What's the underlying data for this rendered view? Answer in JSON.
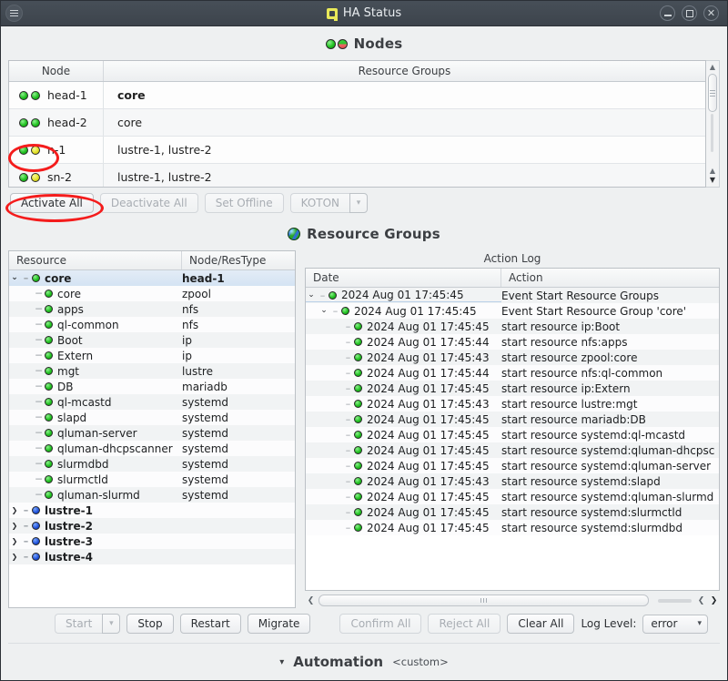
{
  "window": {
    "title": "HA Status",
    "app_icon": "qlustar-icon",
    "menu_icon": "hamburger-menu-icon",
    "minimize_label": "_",
    "maximize_label": "□",
    "close_label": "✕"
  },
  "nodes_section": {
    "title": "Nodes",
    "icon": "node-status-leds-icon",
    "columns": [
      "Node",
      "Resource Groups"
    ],
    "rows": [
      {
        "name": "head-1",
        "led1": "green",
        "led2": "green",
        "groups": "core",
        "bold": true
      },
      {
        "name": "head-2",
        "led1": "green",
        "led2": "green",
        "groups": "core",
        "bold": false
      },
      {
        "name": "n-1",
        "led1": "green",
        "led2": "yellow",
        "groups": "lustre-1, lustre-2",
        "bold": false
      },
      {
        "name": "sn-2",
        "led1": "green",
        "led2": "yellow",
        "groups": "lustre-1, lustre-2",
        "bold": false
      }
    ],
    "buttons": [
      {
        "label": "Activate All",
        "mnemonic": "",
        "disabled": false
      },
      {
        "label": "Deactivate All",
        "mnemonic": "D",
        "disabled": true
      },
      {
        "label": "Set Offline",
        "mnemonic": "O",
        "disabled": true
      },
      {
        "label": "KOTON",
        "mnemonic": "K",
        "disabled": true,
        "split": true
      }
    ]
  },
  "resource_section": {
    "title": "Resource Groups",
    "icon": "globe-icon",
    "tree_columns": [
      "Resource",
      "Node/ResType"
    ],
    "tree_rows": [
      {
        "depth": 0,
        "twisty": "open",
        "led": "green",
        "label": "core",
        "type": "head-1",
        "bold": true,
        "selected": true
      },
      {
        "depth": 1,
        "twisty": "",
        "led": "green",
        "label": "core",
        "type": "zpool",
        "bold": false,
        "selected": false
      },
      {
        "depth": 1,
        "twisty": "",
        "led": "green",
        "label": "apps",
        "type": "nfs",
        "bold": false,
        "selected": false
      },
      {
        "depth": 1,
        "twisty": "",
        "led": "green",
        "label": "ql-common",
        "type": "nfs",
        "bold": false,
        "selected": false
      },
      {
        "depth": 1,
        "twisty": "",
        "led": "green",
        "label": "Boot",
        "type": "ip",
        "bold": false,
        "selected": false
      },
      {
        "depth": 1,
        "twisty": "",
        "led": "green",
        "label": "Extern",
        "type": "ip",
        "bold": false,
        "selected": false
      },
      {
        "depth": 1,
        "twisty": "",
        "led": "green",
        "label": "mgt",
        "type": "lustre",
        "bold": false,
        "selected": false
      },
      {
        "depth": 1,
        "twisty": "",
        "led": "green",
        "label": "DB",
        "type": "mariadb",
        "bold": false,
        "selected": false
      },
      {
        "depth": 1,
        "twisty": "",
        "led": "green",
        "label": "ql-mcastd",
        "type": "systemd",
        "bold": false,
        "selected": false
      },
      {
        "depth": 1,
        "twisty": "",
        "led": "green",
        "label": "slapd",
        "type": "systemd",
        "bold": false,
        "selected": false
      },
      {
        "depth": 1,
        "twisty": "",
        "led": "green",
        "label": "qluman-server",
        "type": "systemd",
        "bold": false,
        "selected": false
      },
      {
        "depth": 1,
        "twisty": "",
        "led": "green",
        "label": "qluman-dhcpscanner",
        "type": "systemd",
        "bold": false,
        "selected": false
      },
      {
        "depth": 1,
        "twisty": "",
        "led": "green",
        "label": "slurmdbd",
        "type": "systemd",
        "bold": false,
        "selected": false
      },
      {
        "depth": 1,
        "twisty": "",
        "led": "green",
        "label": "slurmctld",
        "type": "systemd",
        "bold": false,
        "selected": false
      },
      {
        "depth": 1,
        "twisty": "",
        "led": "green",
        "label": "qluman-slurmd",
        "type": "systemd",
        "bold": false,
        "selected": false
      },
      {
        "depth": 0,
        "twisty": "closed",
        "led": "blue",
        "label": "lustre-1",
        "type": "",
        "bold": true,
        "selected": false
      },
      {
        "depth": 0,
        "twisty": "closed",
        "led": "blue",
        "label": "lustre-2",
        "type": "",
        "bold": true,
        "selected": false
      },
      {
        "depth": 0,
        "twisty": "closed",
        "led": "blue",
        "label": "lustre-3",
        "type": "",
        "bold": true,
        "selected": false
      },
      {
        "depth": 0,
        "twisty": "closed",
        "led": "blue",
        "label": "lustre-4",
        "type": "",
        "bold": true,
        "selected": false
      }
    ],
    "buttons": [
      {
        "label": "Start",
        "mnemonic": "S",
        "disabled": true,
        "split": true
      },
      {
        "label": "Stop",
        "mnemonic": "p",
        "disabled": false
      },
      {
        "label": "Restart",
        "mnemonic": "R",
        "disabled": false
      },
      {
        "label": "Migrate",
        "mnemonic": "M",
        "disabled": false
      }
    ]
  },
  "action_log": {
    "caption": "Action Log",
    "columns": [
      "Date",
      "Action"
    ],
    "rows": [
      {
        "depth": 0,
        "twisty": "open",
        "led": "green",
        "date": "2024 Aug 01 17:45:45",
        "action": "Event Start Resource Groups"
      },
      {
        "depth": 1,
        "twisty": "open",
        "led": "green",
        "date": "2024 Aug 01 17:45:45",
        "action": "Event Start Resource Group 'core'"
      },
      {
        "depth": 2,
        "twisty": "",
        "led": "green",
        "date": "2024 Aug 01 17:45:45",
        "action": "start resource ip:Boot"
      },
      {
        "depth": 2,
        "twisty": "",
        "led": "green",
        "date": "2024 Aug 01 17:45:44",
        "action": "start resource nfs:apps"
      },
      {
        "depth": 2,
        "twisty": "",
        "led": "green",
        "date": "2024 Aug 01 17:45:43",
        "action": "start resource zpool:core"
      },
      {
        "depth": 2,
        "twisty": "",
        "led": "green",
        "date": "2024 Aug 01 17:45:44",
        "action": "start resource nfs:ql-common"
      },
      {
        "depth": 2,
        "twisty": "",
        "led": "green",
        "date": "2024 Aug 01 17:45:45",
        "action": "start resource ip:Extern"
      },
      {
        "depth": 2,
        "twisty": "",
        "led": "green",
        "date": "2024 Aug 01 17:45:43",
        "action": "start resource lustre:mgt"
      },
      {
        "depth": 2,
        "twisty": "",
        "led": "green",
        "date": "2024 Aug 01 17:45:45",
        "action": "start resource mariadb:DB"
      },
      {
        "depth": 2,
        "twisty": "",
        "led": "green",
        "date": "2024 Aug 01 17:45:45",
        "action": "start resource systemd:ql-mcastd"
      },
      {
        "depth": 2,
        "twisty": "",
        "led": "green",
        "date": "2024 Aug 01 17:45:45",
        "action": "start resource systemd:qluman-dhcpsc"
      },
      {
        "depth": 2,
        "twisty": "",
        "led": "green",
        "date": "2024 Aug 01 17:45:45",
        "action": "start resource systemd:qluman-server"
      },
      {
        "depth": 2,
        "twisty": "",
        "led": "green",
        "date": "2024 Aug 01 17:45:43",
        "action": "start resource systemd:slapd"
      },
      {
        "depth": 2,
        "twisty": "",
        "led": "green",
        "date": "2024 Aug 01 17:45:45",
        "action": "start resource systemd:qluman-slurmd"
      },
      {
        "depth": 2,
        "twisty": "",
        "led": "green",
        "date": "2024 Aug 01 17:45:45",
        "action": "start resource systemd:slurmctld"
      },
      {
        "depth": 2,
        "twisty": "",
        "led": "green",
        "date": "2024 Aug 01 17:45:45",
        "action": "start resource systemd:slurmdbd"
      }
    ],
    "buttons": [
      {
        "label": "Confirm All",
        "disabled": true
      },
      {
        "label": "Reject All",
        "disabled": true
      },
      {
        "label": "Clear All",
        "mnemonic": "l",
        "disabled": false
      }
    ],
    "log_level_label": "Log Level:",
    "log_level_value": "error"
  },
  "automation": {
    "chevron": "chevron-down-icon",
    "title": "Automation",
    "value": "<custom>"
  },
  "annotations": {
    "color": "#f41c1c",
    "items": [
      {
        "name": "node-n1-leds-highlight"
      },
      {
        "name": "activate-all-button-highlight"
      }
    ]
  }
}
